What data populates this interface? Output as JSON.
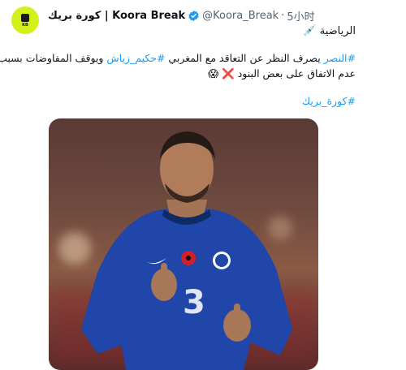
{
  "tweet": {
    "display_name": "كورة بريك | Koora Break",
    "handle": "@Koora_Break",
    "separator": "·",
    "time": "5小时",
    "category_line": "الرياضية",
    "body_line1_tag": "#النصر",
    "body_line1_mid": " يصرف النظر عن التعاقد مع المغربي ",
    "body_line1_tag2": "#حكيم_زياش",
    "body_line1_end": " ويوقف المفاوضات بسبب",
    "body_line2": "عدم الاتفاق على بعض البنود",
    "body_line2_emoji1": "❌",
    "body_line2_emoji2": "😱",
    "hashtag_footer": "#كورة_بريك"
  },
  "colors": {
    "accent": "#1d9bf0",
    "avatar_bg": "#d4f01a",
    "kit_blue": "#1f46a8"
  }
}
